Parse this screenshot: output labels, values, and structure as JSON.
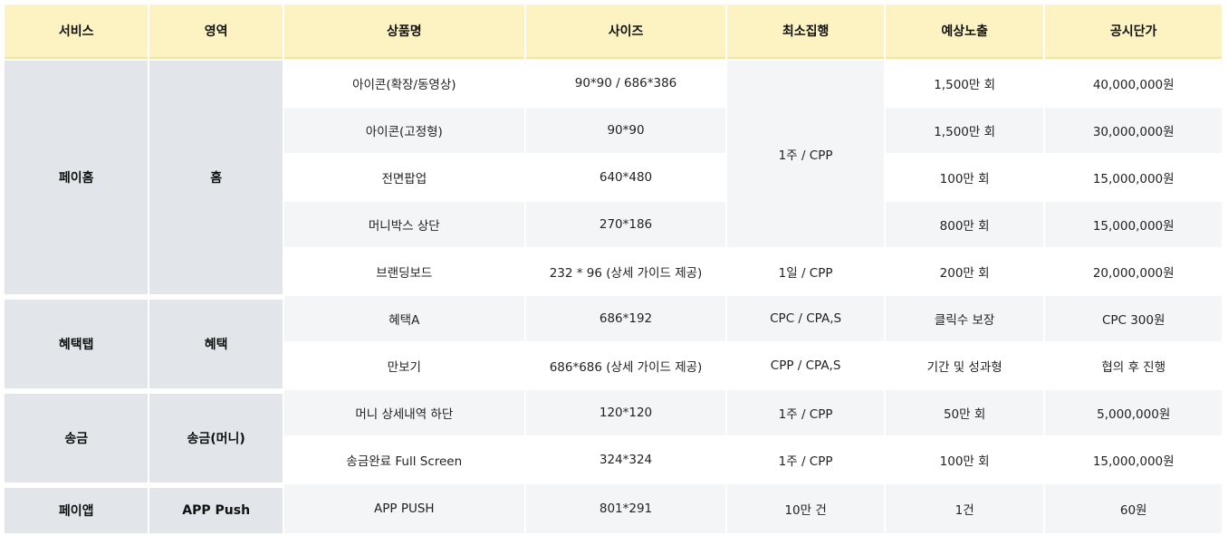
{
  "headers": [
    "서비스",
    "영역",
    "상품명",
    "사이즈",
    "최소집행",
    "예상노출",
    "공시단가"
  ],
  "groups": [
    {
      "service": "페이홈",
      "area": "홈",
      "rows": [
        {
          "product": "아이콘(확장/동영상)",
          "size": "90*90 / 686*386",
          "min": "1주 / CPP",
          "exposure": "1,500만 회",
          "price": "40,000,000원"
        },
        {
          "product": "아이콘(고정형)",
          "size": "90*90",
          "exposure": "1,500만 회",
          "price": "30,000,000원"
        },
        {
          "product": "전면팝업",
          "size": "640*480",
          "exposure": "100만 회",
          "price": "15,000,000원"
        },
        {
          "product": "머니박스 상단",
          "size": "270*186",
          "exposure": "800만 회",
          "price": "15,000,000원"
        },
        {
          "product": "브랜딩보드",
          "size": "232 * 96 (상세 가이드 제공)",
          "min": "1일 / CPP",
          "exposure": "200만 회",
          "price": "20,000,000원"
        }
      ]
    },
    {
      "service": "혜택탭",
      "area": "혜택",
      "rows": [
        {
          "product": "혜택A",
          "size": "686*192",
          "min": "CPC / CPA,S",
          "exposure": "클릭수 보장",
          "price": "CPC 300원"
        },
        {
          "product": "만보기",
          "size": "686*686 (상세 가이드 제공)",
          "min": "CPP / CPA,S",
          "exposure": "기간 및 성과형",
          "price": "협의 후 진행"
        }
      ]
    },
    {
      "service": "송금",
      "area": "송금(머니)",
      "rows": [
        {
          "product": "머니 상세내역 하단",
          "size": "120*120",
          "min": "1주 / CPP",
          "exposure": "50만 회",
          "price": "5,000,000원"
        },
        {
          "product": "송금완료 Full Screen",
          "size": "324*324",
          "min": "1주 / CPP",
          "exposure": "100만 회",
          "price": "15,000,000원"
        }
      ]
    },
    {
      "service": "페이앱",
      "area": "APP Push",
      "rows": [
        {
          "product": "APP PUSH",
          "size": "801*291",
          "min": "10만 건",
          "exposure": "1건",
          "price": "60원"
        }
      ]
    }
  ]
}
